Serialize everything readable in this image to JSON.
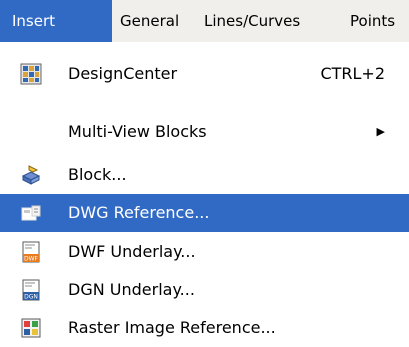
{
  "menubar": {
    "items": [
      {
        "label": "Insert",
        "active": true
      },
      {
        "label": "General"
      },
      {
        "label": "Lines/Curves"
      },
      {
        "label": "Points"
      }
    ]
  },
  "menu": {
    "items": [
      {
        "label": "DesignCenter",
        "shortcut": "CTRL+2",
        "icon": "design-center-icon"
      },
      {
        "label": "Multi-View Blocks",
        "submenu": true
      },
      {
        "label": "Block...",
        "icon": "block-icon"
      },
      {
        "label": "DWG Reference...",
        "icon": "dwg-reference-icon",
        "selected": true
      },
      {
        "label": "DWF Underlay...",
        "icon": "dwf-underlay-icon"
      },
      {
        "label": "DGN Underlay...",
        "icon": "dgn-underlay-icon"
      },
      {
        "label": "Raster Image Reference...",
        "icon": "raster-image-icon"
      }
    ]
  },
  "colors": {
    "highlight": "#316ac5",
    "menubar_bg": "#f0efeb"
  }
}
